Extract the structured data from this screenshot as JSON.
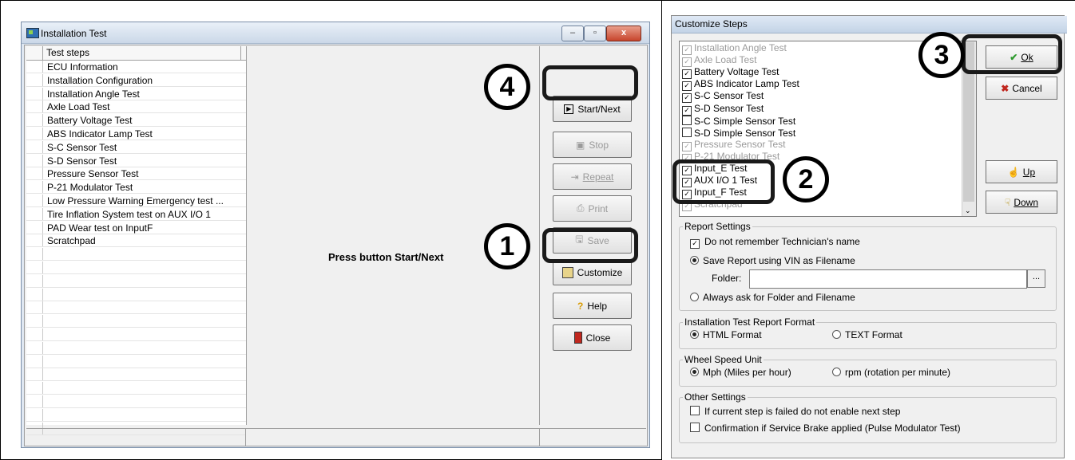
{
  "left_window": {
    "title": "Installation Test",
    "win_buttons": {
      "min": "–",
      "max": "▫",
      "close": "x"
    },
    "steps_header": "Test steps",
    "steps": [
      "ECU Information",
      "Installation Configuration",
      "Installation Angle Test",
      "Axle Load Test",
      "Battery Voltage Test",
      "ABS Indicator Lamp Test",
      "S-C Sensor Test",
      "S-D Sensor Test",
      "Pressure Sensor Test",
      "P-21 Modulator Test",
      "Low Pressure Warning Emergency test ...",
      "Tire Inflation System test on AUX I/O 1",
      "PAD Wear test on InputF",
      "Scratchpad"
    ],
    "message": "Press button Start/Next",
    "buttons": {
      "start_next": "Start/Next",
      "stop": "Stop",
      "repeat": "Repeat",
      "print": "Print",
      "save": "Save",
      "customize": "Customize",
      "help": "Help",
      "close": "Close"
    }
  },
  "callouts": {
    "c1": "1",
    "c2": "2",
    "c3": "3",
    "c4": "4"
  },
  "dialog": {
    "title": "Customize Steps",
    "steps": [
      {
        "label": "Installation Angle Test",
        "checked": true,
        "disabled": true
      },
      {
        "label": "Axle Load Test",
        "checked": true,
        "disabled": true
      },
      {
        "label": "Battery Voltage Test",
        "checked": true,
        "disabled": false
      },
      {
        "label": "ABS Indicator Lamp Test",
        "checked": true,
        "disabled": false
      },
      {
        "label": "S-C Sensor Test",
        "checked": true,
        "disabled": false
      },
      {
        "label": "S-D Sensor Test",
        "checked": true,
        "disabled": false
      },
      {
        "label": "S-C Simple Sensor Test",
        "checked": false,
        "disabled": false
      },
      {
        "label": "S-D Simple Sensor Test",
        "checked": false,
        "disabled": false
      },
      {
        "label": "Pressure Sensor Test",
        "checked": true,
        "disabled": true
      },
      {
        "label": "P-21 Modulator Test",
        "checked": true,
        "disabled": true
      },
      {
        "label": "Input_E Test",
        "checked": true,
        "disabled": false
      },
      {
        "label": "AUX I/O 1 Test",
        "checked": true,
        "disabled": false
      },
      {
        "label": "Input_F Test",
        "checked": true,
        "disabled": false
      },
      {
        "label": "Scratchpad",
        "checked": true,
        "disabled": true
      }
    ],
    "buttons": {
      "ok": "Ok",
      "cancel": "Cancel",
      "up": "Up",
      "down": "Down"
    },
    "report_settings": {
      "caption": "Report Settings",
      "dont_remember": "Do not remember Technician's name",
      "save_vin": "Save Report using VIN as Filename",
      "folder_label": "Folder:",
      "folder_value": "",
      "browse": "...",
      "always_ask": "Always ask for Folder and Filename"
    },
    "report_format": {
      "caption": "Installation Test Report Format",
      "html": "HTML Format",
      "text": "TEXT Format"
    },
    "wheel_speed": {
      "caption": "Wheel Speed Unit",
      "mph": "Mph (Miles per hour)",
      "rpm": "rpm (rotation per minute)"
    },
    "other_settings": {
      "caption": "Other Settings",
      "opt1": "If current step is failed do not enable next step",
      "opt2": "Confirmation if Service Brake applied (Pulse Modulator Test)"
    }
  }
}
